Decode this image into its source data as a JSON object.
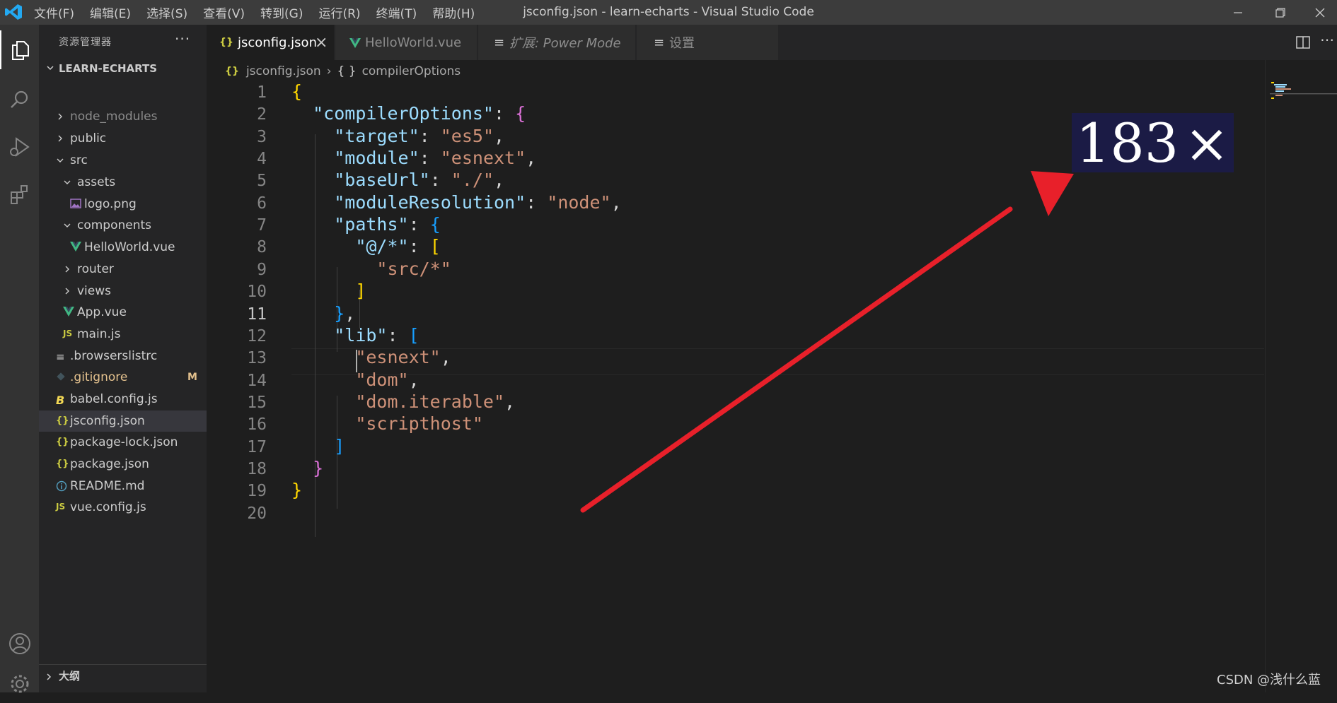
{
  "titlebar": {
    "menus": [
      "文件(F)",
      "编辑(E)",
      "选择(S)",
      "查看(V)",
      "转到(G)",
      "运行(R)",
      "终端(T)",
      "帮助(H)"
    ],
    "window_title": "jsconfig.json - learn-echarts - Visual Studio Code"
  },
  "sidebar": {
    "title": "资源管理器",
    "more": "···",
    "project": "LEARN-ECHARTS",
    "items": [
      {
        "label": "node_modules",
        "icon": "chevron-right",
        "color": "#8b8b8b"
      },
      {
        "label": "public",
        "icon": "chevron-right",
        "color": "#cccccc"
      },
      {
        "label": "src",
        "icon": "chevron-down",
        "color": "#cccccc"
      },
      {
        "label": "assets",
        "icon": "chevron-down",
        "color": "#cccccc"
      },
      {
        "label": "logo.png",
        "icon": "image-icon",
        "color": "#cccccc"
      },
      {
        "label": "components",
        "icon": "chevron-down",
        "color": "#cccccc"
      },
      {
        "label": "HelloWorld.vue",
        "icon": "vue-icon",
        "color": "#cccccc"
      },
      {
        "label": "router",
        "icon": "chevron-right",
        "color": "#cccccc"
      },
      {
        "label": "views",
        "icon": "chevron-right",
        "color": "#cccccc"
      },
      {
        "label": "App.vue",
        "icon": "vue-icon",
        "color": "#cccccc"
      },
      {
        "label": "main.js",
        "icon": "js-icon",
        "color": "#cccccc"
      },
      {
        "label": ".browserslistrc",
        "icon": "lines-icon",
        "color": "#cccccc"
      },
      {
        "label": ".gitignore",
        "icon": "git-icon",
        "color": "#e2c08d",
        "badge": "M"
      },
      {
        "label": "babel.config.js",
        "icon": "babel-icon",
        "color": "#cccccc"
      },
      {
        "label": "jsconfig.json",
        "icon": "json-icon",
        "color": "#cccccc",
        "selected": true
      },
      {
        "label": "package-lock.json",
        "icon": "json-icon",
        "color": "#cccccc"
      },
      {
        "label": "package.json",
        "icon": "json-icon",
        "color": "#cccccc"
      },
      {
        "label": "README.md",
        "icon": "info-icon",
        "color": "#cccccc"
      },
      {
        "label": "vue.config.js",
        "icon": "js-icon",
        "color": "#cccccc"
      }
    ],
    "outline_label": "大纲"
  },
  "tabs": [
    {
      "label": "jsconfig.json",
      "icon": "{}",
      "close": "×"
    },
    {
      "label": "HelloWorld.vue",
      "icon": "V"
    },
    {
      "label": "扩展: Power Mode",
      "icon": "≡"
    },
    {
      "label": "设置",
      "icon": "≡"
    }
  ],
  "breadcrumb": {
    "file_icon": "{}",
    "file": "jsconfig.json",
    "sep": "›",
    "symbol_icon": "{ }",
    "symbol": "compilerOptions"
  },
  "editor": {
    "line_numbers": [
      "1",
      "2",
      "3",
      "4",
      "5",
      "6",
      "7",
      "8",
      "9",
      "10",
      "11",
      "12",
      "13",
      "14",
      "15",
      "16",
      "17",
      "18",
      "19",
      "20"
    ],
    "current_line": 11,
    "lines": [
      [
        {
          "t": "{",
          "c": "b1"
        }
      ],
      [
        {
          "t": "  "
        },
        {
          "t": "\"compilerOptions\"",
          "c": "k"
        },
        {
          "t": ": ",
          "c": "w"
        },
        {
          "t": "{",
          "c": "b2"
        }
      ],
      [
        {
          "t": "    "
        },
        {
          "t": "\"target\"",
          "c": "k"
        },
        {
          "t": ": ",
          "c": "w"
        },
        {
          "t": "\"es5\"",
          "c": "s"
        },
        {
          "t": ",",
          "c": "w"
        }
      ],
      [
        {
          "t": "    "
        },
        {
          "t": "\"module\"",
          "c": "k"
        },
        {
          "t": ": ",
          "c": "w"
        },
        {
          "t": "\"esnext\"",
          "c": "s"
        },
        {
          "t": ",",
          "c": "w"
        }
      ],
      [
        {
          "t": "    "
        },
        {
          "t": "\"baseUrl\"",
          "c": "k"
        },
        {
          "t": ": ",
          "c": "w"
        },
        {
          "t": "\"./\"",
          "c": "s"
        },
        {
          "t": ",",
          "c": "w"
        }
      ],
      [
        {
          "t": "    "
        },
        {
          "t": "\"moduleResolution\"",
          "c": "k"
        },
        {
          "t": ": ",
          "c": "w"
        },
        {
          "t": "\"node\"",
          "c": "s"
        },
        {
          "t": ",",
          "c": "w"
        }
      ],
      [
        {
          "t": "    "
        },
        {
          "t": "\"paths\"",
          "c": "k"
        },
        {
          "t": ": ",
          "c": "w"
        },
        {
          "t": "{",
          "c": "b3"
        }
      ],
      [
        {
          "t": "      "
        },
        {
          "t": "\"@/*\"",
          "c": "k"
        },
        {
          "t": ": ",
          "c": "w"
        },
        {
          "t": "[",
          "c": "b1"
        }
      ],
      [
        {
          "t": "        "
        },
        {
          "t": "\"src/*\"",
          "c": "s"
        }
      ],
      [
        {
          "t": "      "
        },
        {
          "t": "]",
          "c": "b1"
        }
      ],
      [
        {
          "t": "    "
        },
        {
          "t": "}",
          "c": "b3"
        },
        {
          "t": ",",
          "c": "w"
        }
      ],
      [
        {
          "t": "    "
        },
        {
          "t": "\"lib\"",
          "c": "k"
        },
        {
          "t": ": ",
          "c": "w"
        },
        {
          "t": "[",
          "c": "b3"
        }
      ],
      [
        {
          "t": "      "
        },
        {
          "t": "\"esnext\"",
          "c": "s"
        },
        {
          "t": ",",
          "c": "w"
        }
      ],
      [
        {
          "t": "      "
        },
        {
          "t": "\"dom\"",
          "c": "s"
        },
        {
          "t": ",",
          "c": "w"
        }
      ],
      [
        {
          "t": "      "
        },
        {
          "t": "\"dom.iterable\"",
          "c": "s"
        },
        {
          "t": ",",
          "c": "w"
        }
      ],
      [
        {
          "t": "      "
        },
        {
          "t": "\"scripthost\"",
          "c": "s"
        }
      ],
      [
        {
          "t": "    "
        },
        {
          "t": "]",
          "c": "b3"
        }
      ],
      [
        {
          "t": "  "
        },
        {
          "t": "}",
          "c": "b2"
        }
      ],
      [
        {
          "t": "}",
          "c": "b1"
        }
      ],
      []
    ]
  },
  "overlay": {
    "zoom_value": "183",
    "zoom_symbol": "×",
    "arrow_color": "#e8202a"
  },
  "watermark": "CSDN @浅什么蓝",
  "colors": {
    "property_key": "#9cdcfe",
    "string_value": "#ce9178",
    "bracket_gold": "#ffd700",
    "bracket_pink": "#da70d6",
    "bracket_blue": "#179fff",
    "vue_green": "#41b883",
    "json_yellow": "#cbcb41",
    "gitignore_modified": "#e2c08d"
  }
}
